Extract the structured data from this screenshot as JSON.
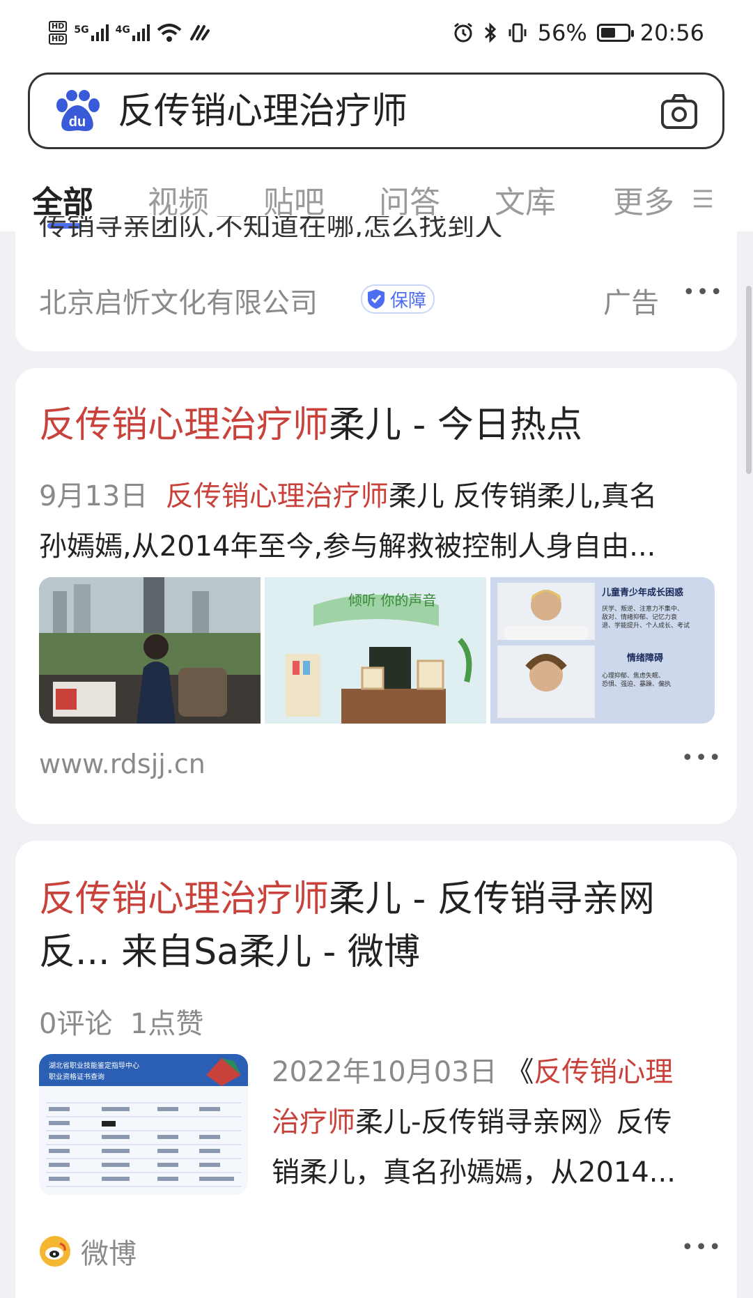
{
  "status_bar": {
    "left_icons": [
      "hd-icon",
      "5g-signal-icon",
      "4g-signal-icon",
      "wifi-icon",
      "nfc-icon"
    ],
    "signal_5g": "5G",
    "signal_4g": "4G",
    "battery_percent": "56%",
    "time": "20:56",
    "battery_level": 0.56
  },
  "search": {
    "query": "反传销心理治疗师"
  },
  "tabs": [
    {
      "label": "全部",
      "active": true
    },
    {
      "label": "视频"
    },
    {
      "label": "贴吧"
    },
    {
      "label": "问答"
    },
    {
      "label": "文库"
    },
    {
      "label": "更多"
    }
  ],
  "ad_card": {
    "truncated_text": "传销寻亲团队,不知道在哪,怎么找到人",
    "company": "北京启忻文化有限公司",
    "badge": "保障",
    "ad_label": "广告"
  },
  "result1": {
    "title_highlight": "反传销心理治疗师",
    "title_rest": "柔儿 - 今日热点",
    "date": "9月13日",
    "snippet_highlight": "反传销心理治疗师",
    "snippet_rest_line1": "柔儿 反传销柔儿,真名",
    "snippet_line2": "孙嫣嫣,从2014年至今,参与解救被控制人身自由...",
    "url": "www.rdsjj.cn",
    "image_texts": [
      "儿童青少年成长困惑",
      "厌学、叛逆、注意力不集中、敌对、情绪抑郁、记忆力衰退、学能提升、个人成长、考试",
      "情绪障碍",
      "心理抑郁、焦虑失眠、恐惧、强迫、暴躁、偏执"
    ],
    "poster_text": "倾听 你的声音"
  },
  "result2": {
    "title_highlight": "反传销心理治疗师",
    "title_rest_line1": "柔儿 - 反传销寻亲网",
    "title_line2": "反... 来自Sa柔儿 - 微博",
    "stats": "0评论  1点赞",
    "date": "2022年10月03日",
    "snippet_open": "《",
    "snippet_highlight1": "反传销心理",
    "snippet_highlight2": "治疗师",
    "snippet_rest1": "柔儿-反传销寻亲网》反传",
    "snippet_line3": "销柔儿，真名孙嫣嫣，从2014...",
    "source": "微博",
    "doc_header": "湖北省职业技能鉴定指导中心",
    "doc_sub": "职业资格证书查询"
  },
  "colors": {
    "highlight": "#c8423b",
    "accent": "#4e6ef2",
    "background": "#f0f1f4"
  }
}
